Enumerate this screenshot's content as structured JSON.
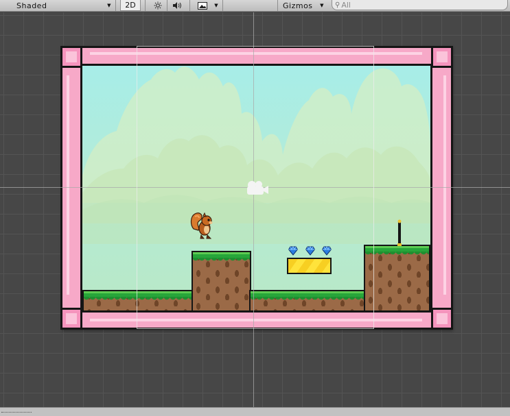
{
  "toolbar": {
    "shading_mode": "Shaded",
    "mode_2d": "2D",
    "gizmos_label": "Gizmos",
    "search_placeholder": "All",
    "icons": {
      "shading_dropdown": "triangle-down-icon",
      "lighting": "sun-icon",
      "audio": "speaker-icon",
      "effects": "image-icon",
      "effects_dropdown": "triangle-down-icon",
      "gizmos_dropdown": "triangle-down-icon",
      "search": "search-icon"
    }
  },
  "scene": {
    "objects": [
      "pink-frame",
      "sky-background",
      "mountain-clouds",
      "ground-left",
      "ground-raised-left",
      "ground-middle",
      "ground-raised-right",
      "yellow-platform",
      "blue-gem",
      "blue-gem",
      "blue-gem",
      "squirrel-player",
      "goal-pole",
      "main-camera-icon"
    ],
    "colors": {
      "frame": "#f7a9c8",
      "sky": "#a7ede8",
      "grass": "#27a63a",
      "dirt": "#9b6a47",
      "platform": "#ffe33b",
      "gem": "#2a7de0",
      "grid": "#555555",
      "editor_bg": "#474747"
    }
  }
}
